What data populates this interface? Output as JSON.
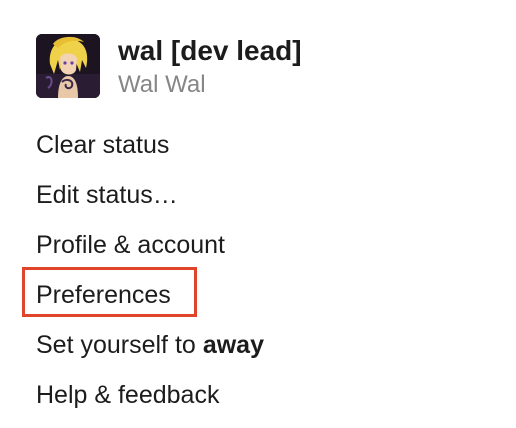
{
  "profile": {
    "display_name": "wal [dev lead]",
    "real_name": "Wal Wal",
    "avatar_icon": "anime-character-avatar"
  },
  "menu": {
    "items": [
      {
        "label": "Clear status"
      },
      {
        "label": "Edit status…"
      },
      {
        "label": "Profile & account"
      },
      {
        "label": "Preferences",
        "highlighted": true
      },
      {
        "label": "Set yourself to",
        "label_bold": "away"
      },
      {
        "label": "Help & feedback"
      }
    ]
  },
  "colors": {
    "text": "#1d1c1d",
    "secondary_text": "#868686",
    "highlight_border": "#e0452c"
  }
}
